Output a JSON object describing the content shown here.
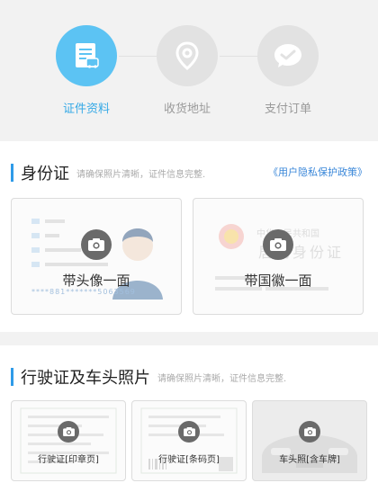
{
  "steps": [
    {
      "label": "证件资料",
      "icon": "document-icon",
      "active": true
    },
    {
      "label": "收货地址",
      "icon": "location-pin-icon",
      "active": false
    },
    {
      "label": "支付订单",
      "icon": "payment-icon",
      "active": false
    }
  ],
  "id_section": {
    "title": "身份证",
    "hint": "请确保照片清晰，证件信息完整.",
    "privacy_link": "《用户隐私保护政策》",
    "slots": [
      {
        "label": "带头像一面",
        "ghost_number": "****881*******5063569"
      },
      {
        "label": "带国徽一面",
        "ghost_title_line1": "中华人民共和国",
        "ghost_title_line2": "居民身份证"
      }
    ]
  },
  "license_section": {
    "title": "行驶证及车头照片",
    "hint": "请确保照片清晰，证件信息完整.",
    "slots": [
      {
        "label": "行驶证[印章页]"
      },
      {
        "label": "行驶证[条码页]"
      },
      {
        "label": "车头照[含车牌]"
      }
    ]
  },
  "colors": {
    "accent": "#5cc3f3",
    "link": "#3a87d9",
    "title_bar": "#2f9be8"
  }
}
